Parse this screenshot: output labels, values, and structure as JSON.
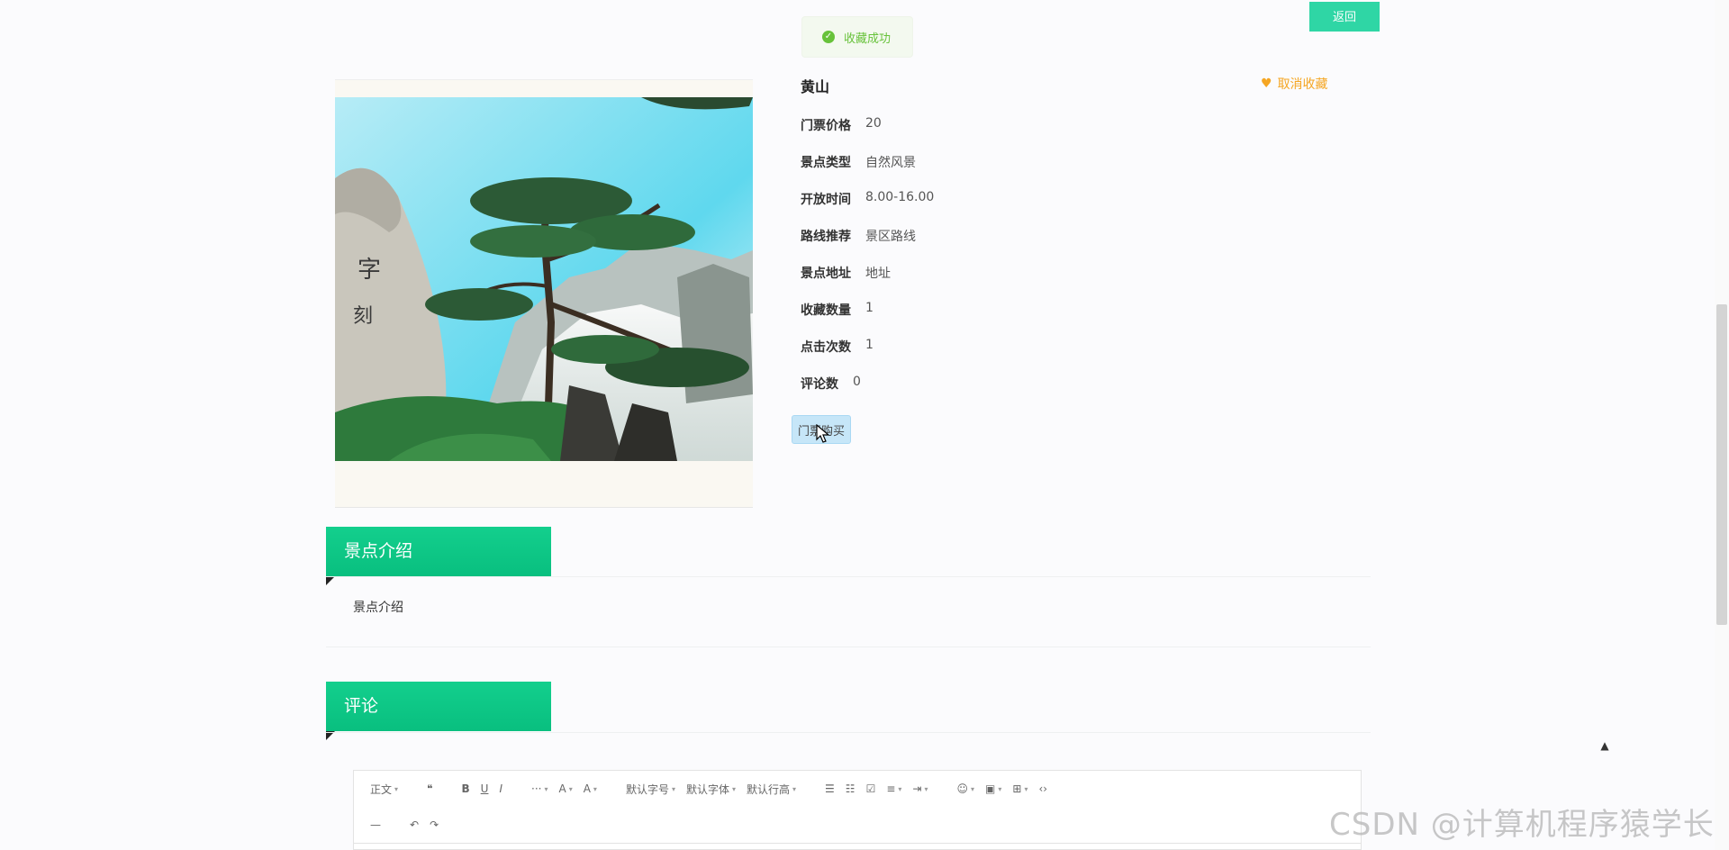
{
  "header": {
    "return_label": "返回"
  },
  "toast": {
    "message": "收藏成功"
  },
  "attraction": {
    "name": "黄山",
    "favorite_label": "取消收藏",
    "fields": [
      {
        "label": "门票价格",
        "value": "20"
      },
      {
        "label": "景点类型",
        "value": "自然风景"
      },
      {
        "label": "开放时间",
        "value": "8.00-16.00"
      },
      {
        "label": "路线推荐",
        "value": "景区路线"
      },
      {
        "label": "景点地址",
        "value": "地址"
      },
      {
        "label": "收藏数量",
        "value": "1"
      },
      {
        "label": "点击次数",
        "value": "1"
      },
      {
        "label": "评论数",
        "value": "0"
      }
    ],
    "buy_label": "门票购买"
  },
  "intro_section": {
    "heading": "景点介绍",
    "content": "景点介绍"
  },
  "comment_section": {
    "heading": "评论"
  },
  "editor": {
    "toolbar": [
      {
        "name": "paragraph-format-select",
        "label": "正文",
        "caret": true
      },
      {
        "name": "quote-icon",
        "label": "❝",
        "caret": false
      },
      {
        "name": "bold-icon",
        "label": "B",
        "caret": false
      },
      {
        "name": "underline-icon",
        "label": "U",
        "caret": false
      },
      {
        "name": "italic-icon",
        "label": "I",
        "caret": false
      },
      {
        "name": "more-icon",
        "label": "···",
        "caret": true
      },
      {
        "name": "font-color-icon",
        "label": "A",
        "caret": true
      },
      {
        "name": "background-color-icon",
        "label": "A",
        "caret": true
      },
      {
        "name": "font-size-select",
        "label": "默认字号",
        "caret": true
      },
      {
        "name": "font-family-select",
        "label": "默认字体",
        "caret": true
      },
      {
        "name": "line-height-select",
        "label": "默认行高",
        "caret": true
      },
      {
        "name": "bulleted-list-icon",
        "label": "☰",
        "caret": false
      },
      {
        "name": "numbered-list-icon",
        "label": "☷",
        "caret": false
      },
      {
        "name": "todo-icon",
        "label": "☑",
        "caret": false
      },
      {
        "name": "align-icon",
        "label": "≡",
        "caret": true
      },
      {
        "name": "indent-icon",
        "label": "⇥",
        "caret": true
      },
      {
        "name": "emoji-icon",
        "label": "☺",
        "caret": true
      },
      {
        "name": "image-icon",
        "label": "▣",
        "caret": true
      },
      {
        "name": "table-icon",
        "label": "⊞",
        "caret": true
      },
      {
        "name": "code-icon",
        "label": "‹›",
        "caret": false
      }
    ],
    "toolbar2": [
      {
        "name": "divider-icon",
        "label": "—",
        "caret": false
      },
      {
        "name": "undo-icon",
        "label": "↶",
        "caret": false
      },
      {
        "name": "redo-icon",
        "label": "↷",
        "caret": false
      }
    ]
  },
  "watermark": "CSDN @计算机程序猿学长"
}
